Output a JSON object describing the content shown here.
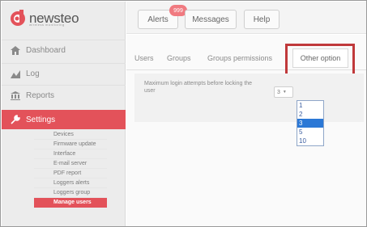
{
  "brand": {
    "name": "newsteo",
    "tagline": "wireless monitoring"
  },
  "colors": {
    "accent": "#e3525a",
    "highlight": "#c0393b",
    "selection": "#2b78d6"
  },
  "header": {
    "alerts_label": "Alerts",
    "alerts_badge": "999",
    "messages_label": "Messages",
    "help_label": "Help"
  },
  "sidebar": {
    "items": [
      {
        "label": "Dashboard",
        "icon": "dashboard-icon"
      },
      {
        "label": "Log",
        "icon": "log-icon"
      },
      {
        "label": "Reports",
        "icon": "reports-icon"
      },
      {
        "label": "Settings",
        "icon": "settings-icon"
      }
    ],
    "settings_sub": [
      "Devices",
      "Firmware update",
      "Interface",
      "E-mail server",
      "PDF report",
      "Loggers alerts",
      "Loggers group",
      "Manage users"
    ]
  },
  "tabs": [
    "Users",
    "Groups",
    "Groups permissions",
    "Other option"
  ],
  "form": {
    "label": "Maximum login attempts before locking the user",
    "selected_value": "3",
    "options": [
      "1",
      "2",
      "3",
      "5",
      "10"
    ]
  }
}
